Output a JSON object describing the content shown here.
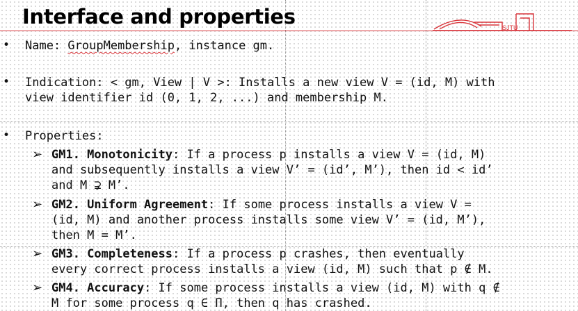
{
  "title": "Interface and properties",
  "name_line": {
    "prefix": "Name: ",
    "module": "GroupMembership",
    "suffix": ", instance gm."
  },
  "indication": {
    "line1": "Indication: < gm, View | V >: Installs a new view V = (id, M) with",
    "line2": "view identifier id (0, 1, 2, ...) and membership M."
  },
  "properties_label": "Properties:",
  "properties": [
    {
      "key": "GM1. Monotonicity",
      "line1": ": If a process p installs a view V = (id, M)",
      "line2": "and subsequently installs a view V’ = (id’, M’), then id < id’",
      "line3": "and M ⊋ M’."
    },
    {
      "key": "GM2. Uniform Agreement",
      "line1": ": If some process installs a view V =",
      "line2": "(id, M) and another process installs some view V’ = (id, M’),",
      "line3": "then M = M’."
    },
    {
      "key": "GM3. Completeness",
      "line1": ": If a process p crashes, then eventually",
      "line2": "every correct process installs a view (id, M) such that p ∉ M."
    },
    {
      "key": "GM4. Accuracy",
      "line1": ": If some process installs a view (id, M) with q ∉",
      "line2": "M for some process q ∈ Π, then q has crashed."
    }
  ],
  "colors": {
    "accent": "#d9343a",
    "text": "#111111"
  },
  "icons": {
    "bullet": "round-bullet",
    "sub_bullet": "arrow-bullet",
    "logo": "campus-gate-logo"
  }
}
